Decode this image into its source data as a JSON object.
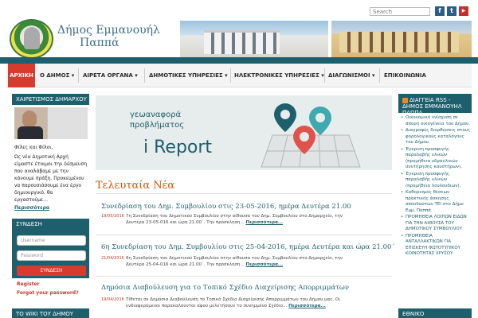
{
  "top": {
    "search_placeholder": "Search",
    "social": [
      {
        "name": "facebook-icon",
        "glyph": "f"
      },
      {
        "name": "twitter-icon",
        "glyph": "t"
      },
      {
        "name": "youtube-icon",
        "glyph": "▶"
      }
    ]
  },
  "header": {
    "title_line1": "Δήμος Εμμανουήλ",
    "title_line2": "Παππά"
  },
  "nav": {
    "items": [
      {
        "label": "ΑΡΧΙΚΗ",
        "active": true
      },
      {
        "label": "Ο ΔΗΜΟΣ ▾"
      },
      {
        "label": "ΑΙΡΕΤΑ ΟΡΓΑΝΑ ▾"
      },
      {
        "label": "ΔΗΜΟΤΙΚΕΣ ΥΠΗΡΕΣΙΕΣ ▾"
      },
      {
        "label": "ΗΛΕΚΤΡΟΝΙΚΕΣ ΥΠΗΡΕΣΙΕΣ ▾"
      },
      {
        "label": "ΔΙΑΓΩΝΙΣΜΟΙ ▾"
      },
      {
        "label": "ΕΠΙΚΟΙΝΩΝΙΑ"
      }
    ]
  },
  "left": {
    "mayor_heading": "ΧΑΙΡΕΤΙΣΜΟΣ ΔΗΜΑΡΧΟΥ",
    "mayor_text_1": "Φίλες και Φίλοι,",
    "mayor_text_2": "Ως νέα Δημοτική Αρχή είμαστε έτοιμοι την δέσμευση που αναλάβαμε με την κάνουμε πράξη. Προκειμένου να παρουσιάσουμε ένα έργο δημιουργικό, θα εργαστούμε...",
    "mayor_more": "Περισσότερα",
    "login_heading": "ΣΥΝΔΕΣΗ",
    "username_placeholder": "Username",
    "password_placeholder": "Password",
    "login_button": "ΣΥΝΔΕΣΗ",
    "register": "Register",
    "forgot": "Forgot your password?",
    "wiki_heading": "ΤΟ WIKI ΤΟΥ ΔΗΜΟΥ"
  },
  "banner": {
    "line1": "γεωαναφορά",
    "line2": "προβλήματος",
    "brand": "i Report"
  },
  "news": {
    "heading": "Τελευταία Νέα",
    "more": "Περισσότερα...",
    "items": [
      {
        "title": "Συνεδρίαση του Δημ. Συμβουλίου στις 23-05-2016, ημέρα Δευτέρα 21.00",
        "date": "19/05/2016",
        "body": "7η Συνεδρίαση του Δημοτικού Συμβουλίου στην αίθουσα του Δημ. Συμβουλίου στο Δημαρχείο, την Δευτέρα 23-05-016 και ώρα 21.00΄. Την πρόσκληση..."
      },
      {
        "title": "6η Συνεδρίαση του Δημ. Συμβουλίου στις 25-04-2016, ημέρα Δευτέρα και ώρα 21.00΄",
        "date": "21/04/2016",
        "body": "6η Συνεδρίαση του Δημοτικού Συμβουλίου στην αίθουσα του Δημ. Συμβουλίου στο Δημαρχείο, την Δευτέρα 25-04-016 και ώρα 21.00΄. Την πρόσκληση..."
      },
      {
        "title": "Δημόσια Διαβούλευση για το Τοπικό Σχέδιο Διαχείρισης Απορριμμάτων",
        "date": "19/04/2016",
        "body": "Τίθεται σε Δημόσια Διαβούλευση το Τοπικό Σχέδιο Διαχείρισης Απορριμμάτων του Δήμου μας. Οι ενδιαφερόμενοι παρακαλούνται αφού μελετήσουν το συνημμένο Σχέδιο..."
      }
    ]
  },
  "right": {
    "rss_heading": "ΔΙΑΓΓΕΙΑ RSS - ΔΗΜΟΣ ΕΜΜΑΝΟΥΗΛ ΠΑΠΠΑ",
    "items": [
      "Οικονομική ενίσχυση σε άπορη οικογένεια του Δήμου.",
      "Διαγραφές διορθώσεις στους φορολογικούς καταλόγους του Δήμου.",
      "Έγκριση προσφυγής παραλαβής υλικών (προμήθεια υδραυλικών συντήρησης καυστήρων).",
      "Έγκριση προσφυγής παραλαβής υλικών (προμήθεια λουλουδιών).",
      "Καθορισμός θέσεων πρακτικής άσκησης σπουδαστών ΤΕΙ στο Δήμο Εμμ. Παππά.",
      "ΠΡΟΜΗΘΕΙΑ ΛΟΙΠΩΝ ΕΙΔΩΝ ΓΙΑ ΤΗΝ ΑΙΘΟΥΣΑ ΤΟΥ ΔΗΜΟΤΙΚΟΥ ΣΥΜΒΟΥΛΙΟΥ",
      "ΠΡΟΜΗΘΕΙΑ ΑΝΤΑΛΛΑΚΤΙΚΩΝ ΓΙΑ ΕΠΙΣΚΕΥΗ ΦΩΤΟΤΥΠΙΚΟΥ ΚΟΙΝΟΤΗΤΑΣ ΧΡΥΣΟΥ"
    ],
    "ethniko_heading": "ΕΘΝΙΚΟ"
  },
  "colors": {
    "accent": "#1e5f6e",
    "red": "#d93a2e",
    "orange": "#d35400"
  }
}
